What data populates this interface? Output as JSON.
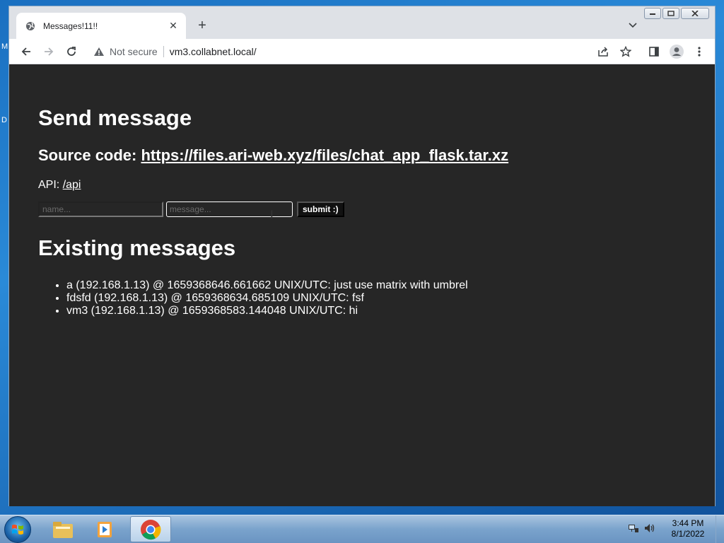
{
  "browser": {
    "tab_title": "Messages!11!!",
    "security_label": "Not secure",
    "url": "vm3.collabnet.local/"
  },
  "page": {
    "heading": "Send message",
    "source_prefix": "Source code: ",
    "source_link": "https://files.ari-web.xyz/files/chat_app_flask.tar.xz",
    "api_prefix": "API: ",
    "api_link": "/api",
    "form": {
      "name_placeholder": "name...",
      "message_placeholder": "message...",
      "submit_label": "submit :)"
    },
    "messages_heading": "Existing messages",
    "messages": [
      "a (192.168.1.13) @ 1659368646.661662 UNIX/UTC: just use matrix with umbrel",
      "fdsfd (192.168.1.13) @ 1659368634.685109 UNIX/UTC: fsf",
      "vm3 (192.168.1.13) @ 1659368583.144048 UNIX/UTC: hi"
    ]
  },
  "taskbar": {
    "time": "3:44 PM",
    "date": "8/1/2022"
  },
  "desktop": {
    "edge_letters": [
      "M",
      "D"
    ]
  }
}
